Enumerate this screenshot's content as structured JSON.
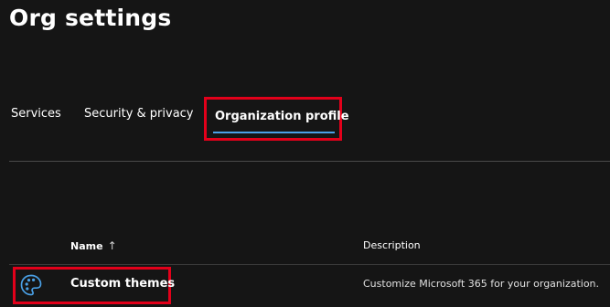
{
  "page": {
    "title": "Org settings"
  },
  "tabs": [
    {
      "label": "Services",
      "selected": false
    },
    {
      "label": "Security & privacy",
      "selected": false
    },
    {
      "label": "Organization profile",
      "selected": true
    }
  ],
  "table": {
    "columns": [
      {
        "label": "Name",
        "sort": "ascending",
        "sort_icon": "arrow-up-icon"
      },
      {
        "label": "Description"
      }
    ],
    "rows": [
      {
        "icon": "palette-icon",
        "name": "Custom themes",
        "description": "Customize Microsoft 365 for your organization."
      }
    ]
  },
  "colors": {
    "background": "#151515",
    "text": "#ffffff",
    "accent": "#4aa0e6",
    "highlight_border": "#e2001a",
    "divider": "#4a4a4a"
  },
  "sort_glyph": "↑"
}
